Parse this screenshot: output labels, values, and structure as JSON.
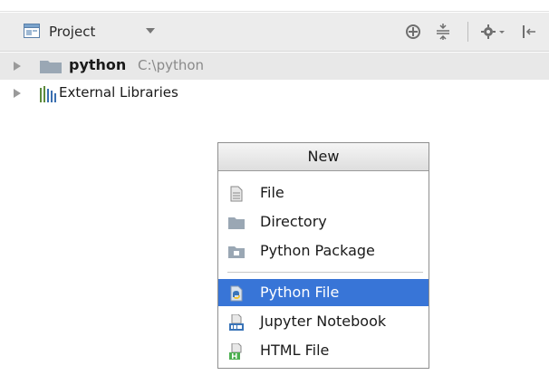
{
  "toolbar": {
    "view_label": "Project",
    "icons": [
      "project-view-icon",
      "dropdown-caret-icon",
      "locate-icon",
      "collapse-all-icon",
      "settings-icon",
      "hide-panel-icon"
    ]
  },
  "tree": {
    "root_name": "python",
    "root_path": "C:\\python",
    "external_libraries": "External Libraries"
  },
  "new_menu": {
    "title": "New",
    "items": [
      {
        "label": "File",
        "icon": "file-icon"
      },
      {
        "label": "Directory",
        "icon": "directory-icon"
      },
      {
        "label": "Python Package",
        "icon": "python-package-icon"
      },
      {
        "label": "Python File",
        "icon": "python-file-icon",
        "selected": true
      },
      {
        "label": "Jupyter Notebook",
        "icon": "jupyter-notebook-icon"
      },
      {
        "label": "HTML File",
        "icon": "html-file-icon"
      }
    ]
  },
  "colors": {
    "selection": "#3875d7",
    "toolbar_bg": "#ececec",
    "path_text": "#8a8a8a"
  }
}
